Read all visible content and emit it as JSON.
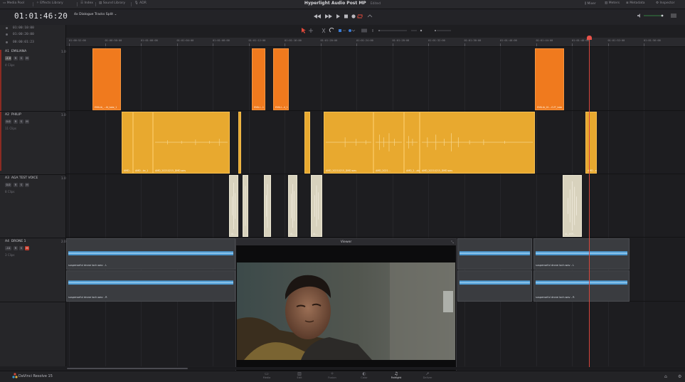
{
  "topbar": {
    "items": [
      "Media Pool",
      "Effects Library",
      "Index",
      "Sound Library",
      "ADR"
    ],
    "title": "Hyperlight Audio Post MP",
    "status": "Edited",
    "right_items": [
      "Mixer",
      "Meters",
      "Metadata",
      "Inspector"
    ]
  },
  "timecode": {
    "main": "01:01:46:20",
    "rows": [
      "01:00:10:00",
      "01:00:20:00",
      "00:00:01:23"
    ]
  },
  "track_selector": {
    "label": "4x Dialogue Tracks Split"
  },
  "ruler": {
    "labels": [
      "01:00:52:00",
      "01:00:56:00",
      "01:01:00:00",
      "01:01:04:00",
      "01:01:08:00",
      "01:01:12:00",
      "01:01:16:00",
      "01:01:20:00",
      "01:01:24:00",
      "01:01:28:00",
      "01:01:32:00",
      "01:01:36:00",
      "01:01:40:00",
      "01:01:44:00",
      "01:01:48:00",
      "01:01:52:00",
      "01:01:56:00"
    ]
  },
  "tracks": [
    {
      "id": "A1",
      "name": "EMILIANA",
      "channels": "1.0",
      "volume": "-4.6",
      "clips": "4 Clips",
      "buttons": [
        "R",
        "S",
        "M"
      ]
    },
    {
      "id": "A2",
      "name": "PHILIP",
      "channels": "1.0",
      "volume": "0.0",
      "clips": "11 Clips",
      "buttons": [
        "R",
        "S",
        "M"
      ]
    },
    {
      "id": "A3",
      "name": "AGA TEST VOICE",
      "channels": "1.0",
      "volume": "0.0",
      "clips": "8 Clips",
      "buttons": [
        "R",
        "S",
        "M"
      ]
    },
    {
      "id": "A4",
      "name": "DRONE 1",
      "channels": "2.0",
      "volume": "-11",
      "clips": "3 Clips",
      "buttons": [
        "R",
        "S",
        "M"
      ]
    }
  ],
  "clip_labels": {
    "a1": [
      "EMILIA_...ilt_take_1",
      "EMILI...1",
      "EMILI...4_1",
      "EMILIA_01...CUT_take"
    ],
    "a2": [
      "AMD...",
      "AMD...ke_1",
      "AMD_20210215_DMD.wav",
      "AMD_20210215_DMD.wav",
      "AMD_2021...",
      "AMD_2...ake_1",
      "AMD_20210215_DMD.wav",
      "AMD...ak"
    ],
    "a3": [
      "AL...",
      "AL...",
      "AL...",
      "AL_ASR..."
    ],
    "a4": [
      "suspenseful drone loch.wav - L",
      "suspenseful drone loch.wav - R",
      "suspenseful drone loch.wav - L",
      "suspenseful drone loch.wav - R"
    ]
  },
  "viewer": {
    "title": "Viewer"
  },
  "bottombar": {
    "brand": "DaVinci Resolve 15",
    "pages": [
      "Media",
      "Edit",
      "Fusion",
      "Color",
      "Fairlight",
      "Deliver"
    ],
    "active_page": "Fairlight"
  },
  "colors": {
    "clip_orange": "#f07a1e",
    "clip_yellow": "#e8a92f",
    "clip_grey": "#d8d2bd",
    "waveform_blue": "#4d9bd3",
    "playhead": "#e8524a"
  },
  "icons": [
    "media-pool-icon",
    "effects-icon",
    "index-icon",
    "sound-library-icon",
    "adr-icon",
    "mixer-icon",
    "meters-icon",
    "metadata-icon",
    "inspector-icon",
    "home-icon",
    "settings-icon"
  ]
}
